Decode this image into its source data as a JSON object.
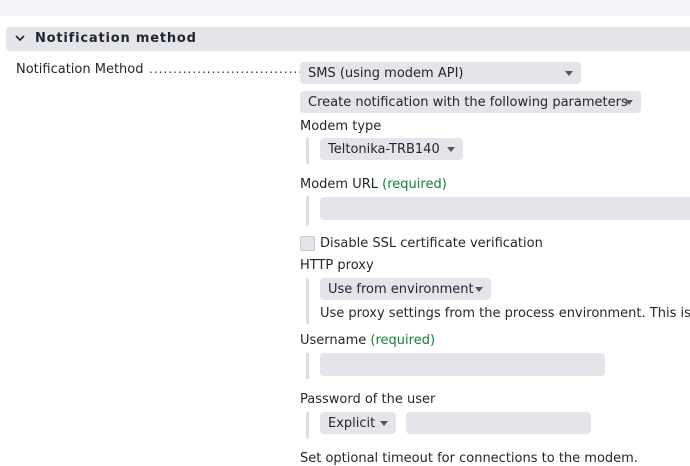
{
  "section": {
    "title": "Notification method",
    "toggle_icon": "chevron-down-icon"
  },
  "method": {
    "label": "Notification Method",
    "dots": "...................................",
    "select_value": "SMS (using modem API)",
    "params_select": "Create notification with the following parameters"
  },
  "modem_type": {
    "label": "Modem type",
    "value": "Teltonika-TRB140"
  },
  "modem_url": {
    "label": "Modem URL",
    "required": "(required)",
    "value": ""
  },
  "ssl": {
    "label": "Disable SSL certificate verification",
    "checked": false
  },
  "http_proxy": {
    "label": "HTTP proxy",
    "value": "Use from environment",
    "help": "Use proxy settings from the process environment. This is th"
  },
  "username": {
    "label": "Username",
    "required": "(required)",
    "value": ""
  },
  "password": {
    "label": "Password of the user",
    "mode": "Explicit",
    "value": ""
  },
  "timeout": {
    "label": "Set optional timeout for connections to the modem."
  }
}
